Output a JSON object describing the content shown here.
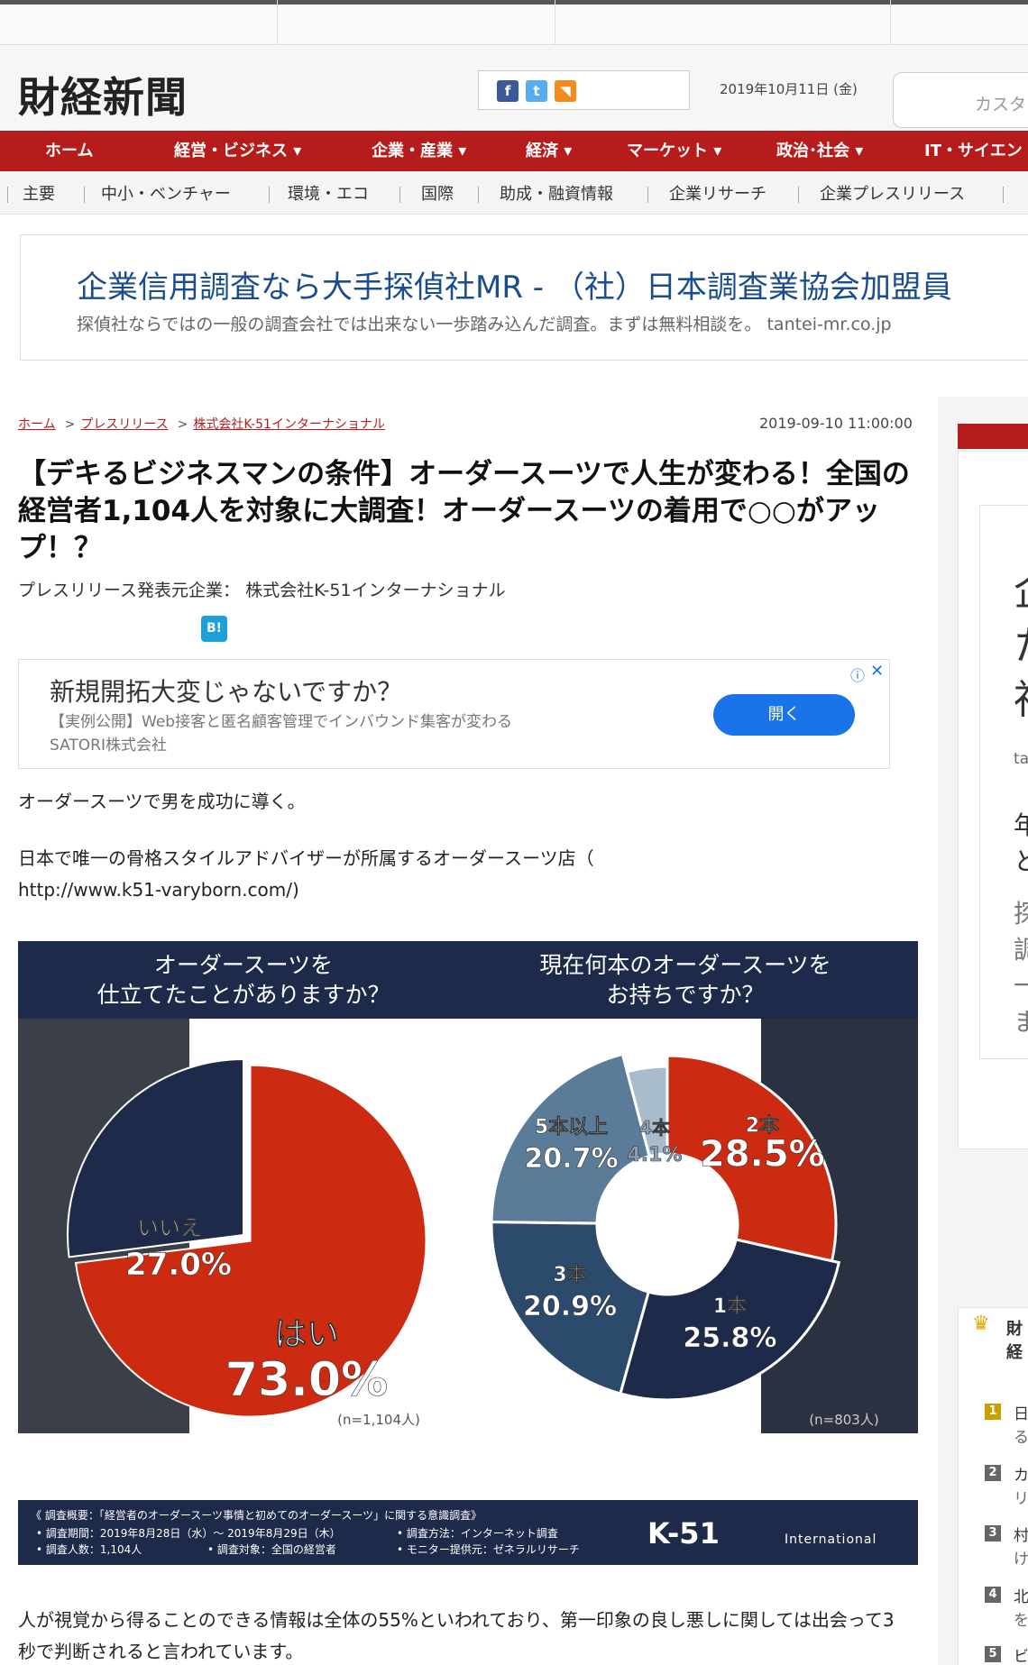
{
  "site": {
    "logo": "財経新聞",
    "date": "2019年10月11日 (金)",
    "search_placeholder": "カスタ"
  },
  "colors": {
    "brand_red": "#b71c1c",
    "navy": "#1e2a4a",
    "chart_red": "#cc2b12",
    "link_blue": "#1a73e8"
  },
  "main_nav": [
    "ホーム",
    "経営・ビジネス ▾",
    "企業・産業 ▾",
    "経済 ▾",
    "マーケット ▾",
    "政治･社会 ▾",
    "IT・サイエン"
  ],
  "sub_nav": [
    "主要",
    "中小・ベンチャー",
    "環境・エコ",
    "国際",
    "助成・融資情報",
    "企業リサーチ",
    "企業プレスリリース"
  ],
  "top_ad": {
    "title": "企業信用調査なら大手探偵社MR - （社）日本調査業協会加盟員",
    "desc": "探偵社ならではの一般の調査会社では出来ない一歩踏み込んだ調査。まずは無料相談を。 tantei-mr.co.jp"
  },
  "breadcrumb": {
    "home": "ホーム",
    "press": "プレスリリース",
    "company": "株式会社K-51インターナショナル",
    "sep": ">"
  },
  "article": {
    "time": "2019-09-10 11:00:00",
    "title": "【デキるビジネスマンの条件】オーダースーツで人生が変わる！全国の経営者1,104人を対象に大調査！オーダースーツの着用で○○がアップ！？",
    "press_from": "プレスリリース発表元企業： 株式会社K-51インターナショナル",
    "hatena_label": "B!",
    "para1": "オーダースーツで男を成功に導く。",
    "para2": "日本で唯一の骨格スタイルアドバイザーが所属するオーダースーツ店（ http://www.k51-varyborn.com/)",
    "para3": "人が視覚から得ることのできる情報は全体の55%といわれており、第一印象の良し悪しに関しては出会って3秒で判断されると言われています。"
  },
  "inline_ad": {
    "title": "新規開拓大変じゃないですか？",
    "desc": "【実例公開】Web接客と匿名顧客管理でインバウンド集客が変わる SATORI株式会社",
    "button": "開く",
    "info": "ⓘ",
    "close": "✕"
  },
  "infographic": {
    "q1": "オーダースーツを\n仕立てたことがありますか？",
    "q2": "現在何本のオーダースーツを\nお持ちですか？",
    "foot1": "《 調査概要：「経営者のオーダースーツ事情と初めてのオーダースーツ」に関する意識調査》",
    "foot2": "• 調査期間：2019年8月28日（水）～ 2019年8月29日（木）",
    "foot3": "• 調査人数：1,104人",
    "foot4": "• 調査対象：全国の経営者",
    "foot5": "• 調査方法：インターネット調査",
    "foot6": "• モニター提供元：ゼネラルリサーチ",
    "brand": "K-51",
    "brand_sub": "International"
  },
  "chart_data": [
    {
      "type": "pie",
      "title": "オーダースーツを仕立てたことがありますか？",
      "note": "(n=1,104人)",
      "slices": [
        {
          "label": "はい",
          "value": 73.0,
          "value_text": "73.0%",
          "color": "#cc2b12"
        },
        {
          "label": "いいえ",
          "value": 27.0,
          "value_text": "27.0%",
          "color": "#1e2a4a"
        }
      ]
    },
    {
      "type": "pie",
      "title": "現在何本のオーダースーツをお持ちですか？",
      "note": "(n=803人)",
      "slices": [
        {
          "label": "2本",
          "value": 28.5,
          "value_text": "28.5%",
          "color": "#cc2b12"
        },
        {
          "label": "1本",
          "value": 25.8,
          "value_text": "25.8%",
          "color": "#1e2a4a"
        },
        {
          "label": "3本",
          "value": 20.9,
          "value_text": "20.9%",
          "color": "#2c4a6b"
        },
        {
          "label": "5本以上",
          "value": 20.7,
          "value_text": "20.7%",
          "color": "#5a7c99"
        },
        {
          "label": "4本",
          "value": 4.1,
          "value_text": "4.1%",
          "color": "#a8bccb"
        }
      ]
    }
  ],
  "sidebar": {
    "glyphs": [
      "企",
      "た",
      "社",
      "ta",
      "年",
      "と",
      "探",
      "調",
      "一",
      "ま"
    ],
    "rank_title": "財経",
    "rank_items": [
      "日",
      "カ",
      "村",
      "北",
      "ビ"
    ],
    "rank_items2": [
      "る",
      "リ",
      "け",
      "を"
    ]
  }
}
